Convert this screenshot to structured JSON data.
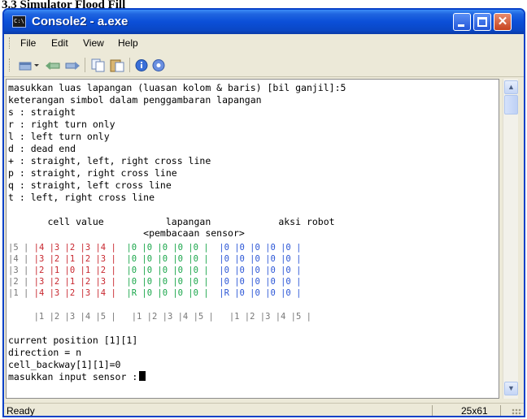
{
  "document": {
    "heading": "3.3 Simulator Flood Fill"
  },
  "window": {
    "title": "Console2 - a.exe",
    "app_icon_text": "C:\\"
  },
  "menu": [
    "File",
    "Edit",
    "View",
    "Help"
  ],
  "toolbar": {
    "icons": [
      "new-tab-icon",
      "new-tab-dropdown-icon",
      "previous-tab-icon",
      "next-tab-icon",
      "copy-icon",
      "paste-icon",
      "info-icon",
      "help-icon"
    ]
  },
  "console": {
    "lines": [
      "masukkan luas lapangan (luasan kolom & baris) [bil ganjil]:5",
      "keterangan simbol dalam penggambaran lapangan",
      "s : straight",
      "r : right turn only",
      "l : left turn only",
      "d : dead end",
      "+ : straight, left, right cross line",
      "p : straight, right cross line",
      "q : straight, left cross line",
      "t : left, right cross line",
      "",
      "       cell value           lapangan            aksi robot",
      "                        <pembacaan sensor>"
    ],
    "grid_rows": [
      {
        "row": "|5 |",
        "cell": "|4 |3 |2 |3 |4 |",
        "field": "|0 |0 |0 |0 |0 |",
        "robot": "|0 |0 |0 |0 |0 |"
      },
      {
        "row": "|4 |",
        "cell": "|3 |2 |1 |2 |3 |",
        "field": "|0 |0 |0 |0 |0 |",
        "robot": "|0 |0 |0 |0 |0 |"
      },
      {
        "row": "|3 |",
        "cell": "|2 |1 |0 |1 |2 |",
        "field": "|0 |0 |0 |0 |0 |",
        "robot": "|0 |0 |0 |0 |0 |"
      },
      {
        "row": "|2 |",
        "cell": "|3 |2 |1 |2 |3 |",
        "field": "|0 |0 |0 |0 |0 |",
        "robot": "|0 |0 |0 |0 |0 |"
      },
      {
        "row": "|1 |",
        "cell": "|4 |3 |2 |3 |4 |",
        "field": "|R |0 |0 |0 |0 |",
        "robot": "|R |0 |0 |0 |0 |"
      }
    ],
    "column_footer": "     |1 |2 |3 |4 |5 |   |1 |2 |3 |4 |5 |   |1 |2 |3 |4 |5 |",
    "status_lines": [
      "current position [1][1]",
      "direction = n",
      "cell_backway[1][1]=0"
    ],
    "prompt": "masukkan input sensor :"
  },
  "statusbar": {
    "left": "Ready",
    "size": "25x61"
  },
  "colors": {
    "cell_value": "#c8262e",
    "lapangan": "#1aa64a",
    "aksi_robot": "#2b56d6",
    "row_index": "#777777",
    "titlebar": "#0b4fd8"
  }
}
